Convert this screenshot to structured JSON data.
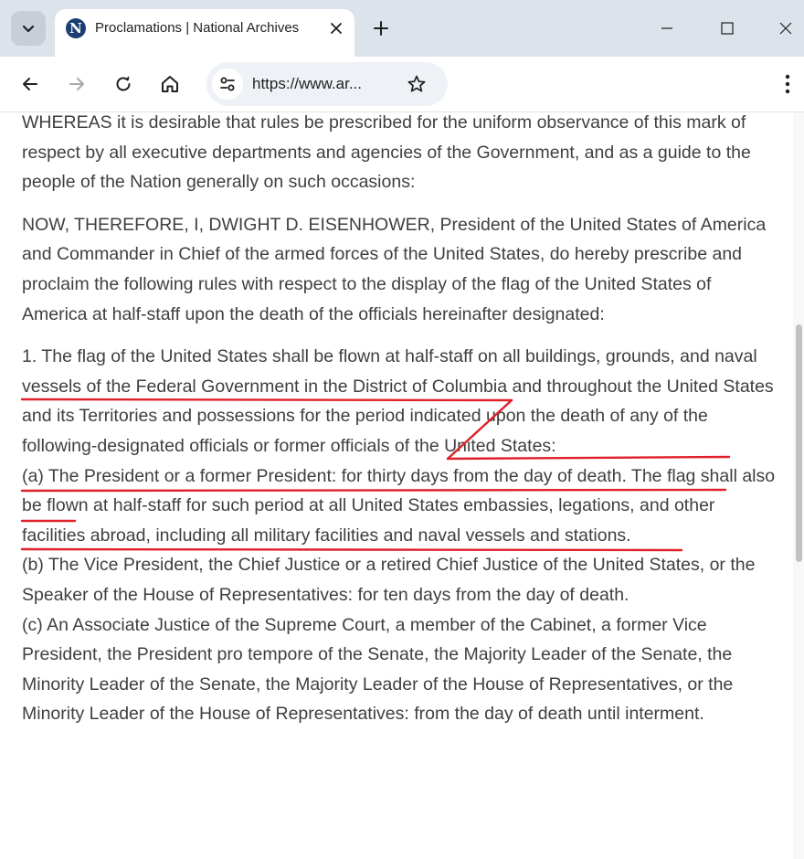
{
  "browser": {
    "tab": {
      "title": "Proclamations | National Archives",
      "favicon_letter": "N"
    },
    "address_bar": {
      "url": "https://www.ar..."
    },
    "icons": {
      "tab_search": "chevron-down-icon",
      "tab_close": "close-icon",
      "new_tab": "plus-icon",
      "minimize": "minimize-icon",
      "maximize": "maximize-icon",
      "close_window": "close-icon",
      "back": "arrow-left-icon",
      "forward": "arrow-right-icon",
      "reload": "reload-icon",
      "home": "home-icon",
      "site_info": "tune-icon",
      "bookmark": "star-icon",
      "menu": "kebab-menu-icon"
    },
    "colors": {
      "tabstrip_bg": "#dde3ea",
      "favicon_bg": "#1d3e73",
      "annotation_red": "#e0202a",
      "body_text": "#3f3f3f"
    }
  },
  "document": {
    "paragraphs": {
      "whereas": "WHEREAS it is desirable that rules be prescribed for the uniform observance of this mark of respect by all executive departments and agencies of the Government, and as a guide to the people of the Nation generally on such occasions:",
      "now_therefore": "NOW, THEREFORE, I, DWIGHT D. EISENHOWER, President of the United States of America and Commander in Chief of the armed forces of the United States, do hereby prescribe and proclaim the following rules with respect to the display of the flag of the United States of America at half-staff upon the death of the officials hereinafter designated:",
      "rule_1": "1. The flag of the United States shall be flown at half-staff on all buildings, grounds, and naval vessels of the Federal Government in the District of Columbia and throughout the United States and its Territories and possessions for the period indicated upon the death of any of the following-designated officials or former officials of the United States:",
      "item_a": "(a) The President or a former President: for thirty days from the day of death. The flag shall also be flown at half-staff for such period at all United States embassies, legations, and other facilities abroad, including all military facilities and naval vessels and stations.",
      "item_b": "(b) The Vice President, the Chief Justice or a retired Chief Justice of the United States, or the Speaker of the House of Representatives: for ten days from the day of death.",
      "item_c": "(c) An Associate Justice of the Supreme Court, a member of the Cabinet, a former Vice President, the President pro tempore of the Senate, the Majority Leader of the Senate, the Minority Leader of the Senate, the Majority Leader of the House of Representatives, or the Minority Leader of the House of Representatives: from the day of death until interment."
    }
  }
}
